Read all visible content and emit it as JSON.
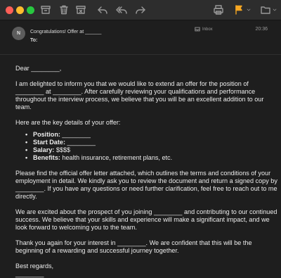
{
  "colors": {
    "traffic_close": "#fe5f57",
    "traffic_minimize": "#febc2e",
    "traffic_maximize": "#28c840",
    "flag": "#f5a623",
    "background": "#1e1e1e",
    "toolbar": "#2d2d2d"
  },
  "toolbar": {
    "icons": [
      "archive-icon",
      "trash-icon",
      "junk-icon",
      "reply-icon",
      "reply-all-icon",
      "forward-icon",
      "print-icon",
      "flag-icon",
      "move-to-folder-icon"
    ]
  },
  "header": {
    "avatar_initial": "N",
    "subject": "Congratulations! Offer at ______",
    "to_label": "To:",
    "mailbox": "Inbox",
    "time": "20:36"
  },
  "message": {
    "greeting": "Dear ________,",
    "paragraph1": "I am delighted to inform you that we would like to extend an offer for the position of ________ at ________. After carefully reviewing your qualifications and performance throughout the interview process, we believe that you will be an excellent addition to our team.",
    "details_intro": "Here are the key details of your offer:",
    "details": [
      {
        "label": "Position:",
        "value": " ________"
      },
      {
        "label": "Start Date:",
        "value": " ________"
      },
      {
        "label": "Salary:",
        "value": " $$$$"
      },
      {
        "label": "Benefits:",
        "value": " health insurance, retirement plans, etc."
      }
    ],
    "paragraph2": "Please find the official offer letter attached, which outlines the terms and conditions of your employment in detail. We kindly ask you to review the document and return a signed copy by ________. If you have any questions or need further clarification, feel free to reach out to me directly.",
    "paragraph3": "We are excited about the prospect of you joining ________ and contributing to our continued success. We believe that your skills and experience will make a significant impact, and we look forward to welcoming you to the team.",
    "paragraph4": "Thank you again for your interest in ________. We are confident that this will be the beginning of a rewarding and successful journey together.",
    "closing": "Best regards,",
    "signature": "________"
  }
}
